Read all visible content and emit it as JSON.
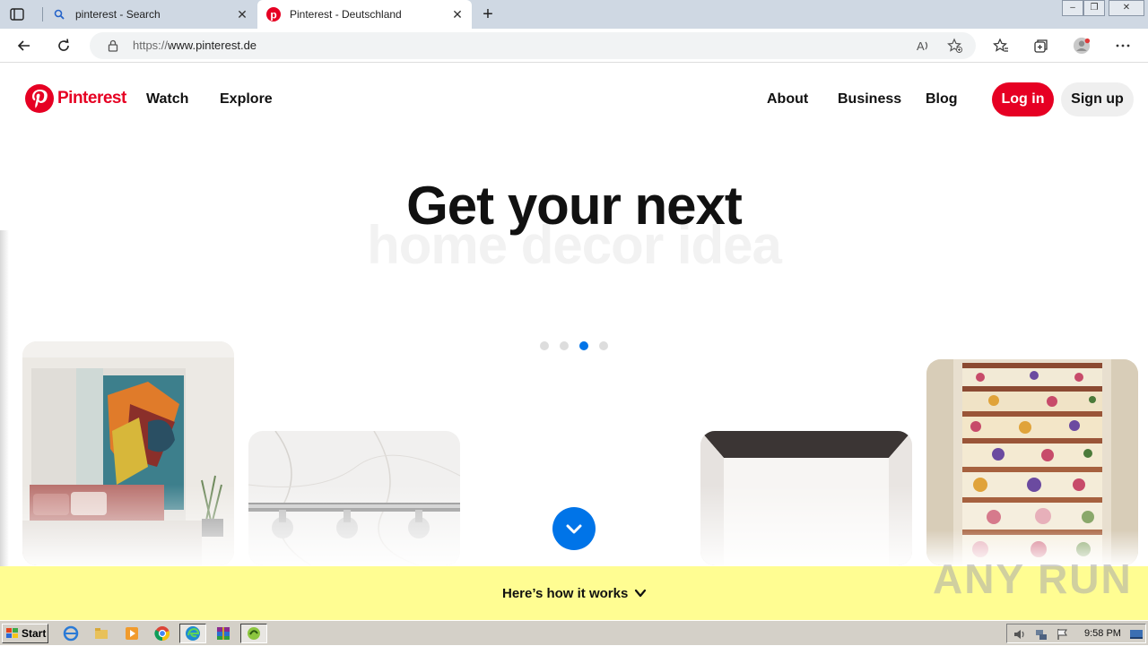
{
  "browser": {
    "tabs": [
      {
        "title": "pinterest - Search",
        "active": false
      },
      {
        "title": "Pinterest - Deutschland",
        "active": true
      }
    ],
    "url_scheme": "https://",
    "url_host": "www.pinterest.de"
  },
  "site": {
    "brand": "Pinterest",
    "brand_color": "#e60023",
    "nav_left": [
      "Watch",
      "Explore"
    ],
    "nav_right": [
      "About",
      "Business",
      "Blog"
    ],
    "login_label": "Log in",
    "signup_label": "Sign up"
  },
  "hero": {
    "title": "Get your next",
    "subtitle": "home decor idea",
    "carousel_total": 4,
    "carousel_active_index": 2,
    "accent": "#0074e8"
  },
  "footer_bar": {
    "label": "Here’s how it works",
    "bg": "#fffd92"
  },
  "watermark": "ANY RUN",
  "taskbar": {
    "start_label": "Start",
    "clock": "9:58 PM"
  }
}
